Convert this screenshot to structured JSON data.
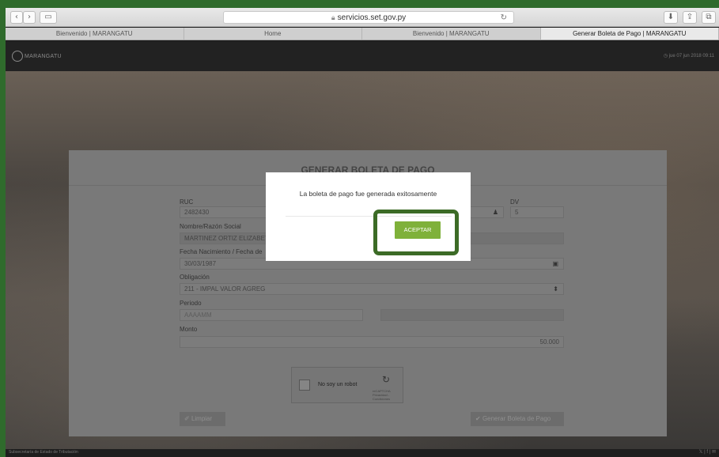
{
  "browser": {
    "url": "servicios.set.gov.py",
    "tabs": [
      {
        "label": "Bienvenido | MARANGATU"
      },
      {
        "label": "Home"
      },
      {
        "label": "Bienvenido | MARANGATU"
      },
      {
        "label": "Generar Boleta de Pago | MARANGATU"
      }
    ]
  },
  "header": {
    "brand": "MARANGATU",
    "datetime": "jue 07 jun 2018 09:11"
  },
  "form": {
    "title": "GENERAR BOLETA DE PAGO",
    "ruc_label": "RUC",
    "ruc_value": "2482430",
    "dv_label": "DV",
    "dv_value": "5",
    "name_label": "Nombre/Razón Social",
    "name_value": "MARTINEZ ORTIZ ELIZABETH RAMONA",
    "birth_label": "Fecha Nacimiento / Fecha de",
    "birth_value": "30/03/1987",
    "obligation_label": "Obligación",
    "obligation_value": "211 - IMPAL VALOR AGREG",
    "period_label": "Periodo",
    "period_placeholder": "AAAAMM",
    "amount_label": "Monto",
    "amount_value": "50.000",
    "captcha_text": "No soy un robot",
    "captcha_brand": "reCAPTCHA",
    "captcha_links": "Privacidad - Condiciones",
    "clear_button": "Limpiar",
    "generate_button": "Generar Boleta de Pago"
  },
  "modal": {
    "message": "La boleta de pago fue generada exitosamente",
    "accept_button": "ACEPTAR"
  },
  "footer": {
    "text": "Subsecretaría de Estado de Tributación"
  },
  "colors": {
    "accent": "#7fb13a",
    "highlight": "#3c6b26"
  }
}
